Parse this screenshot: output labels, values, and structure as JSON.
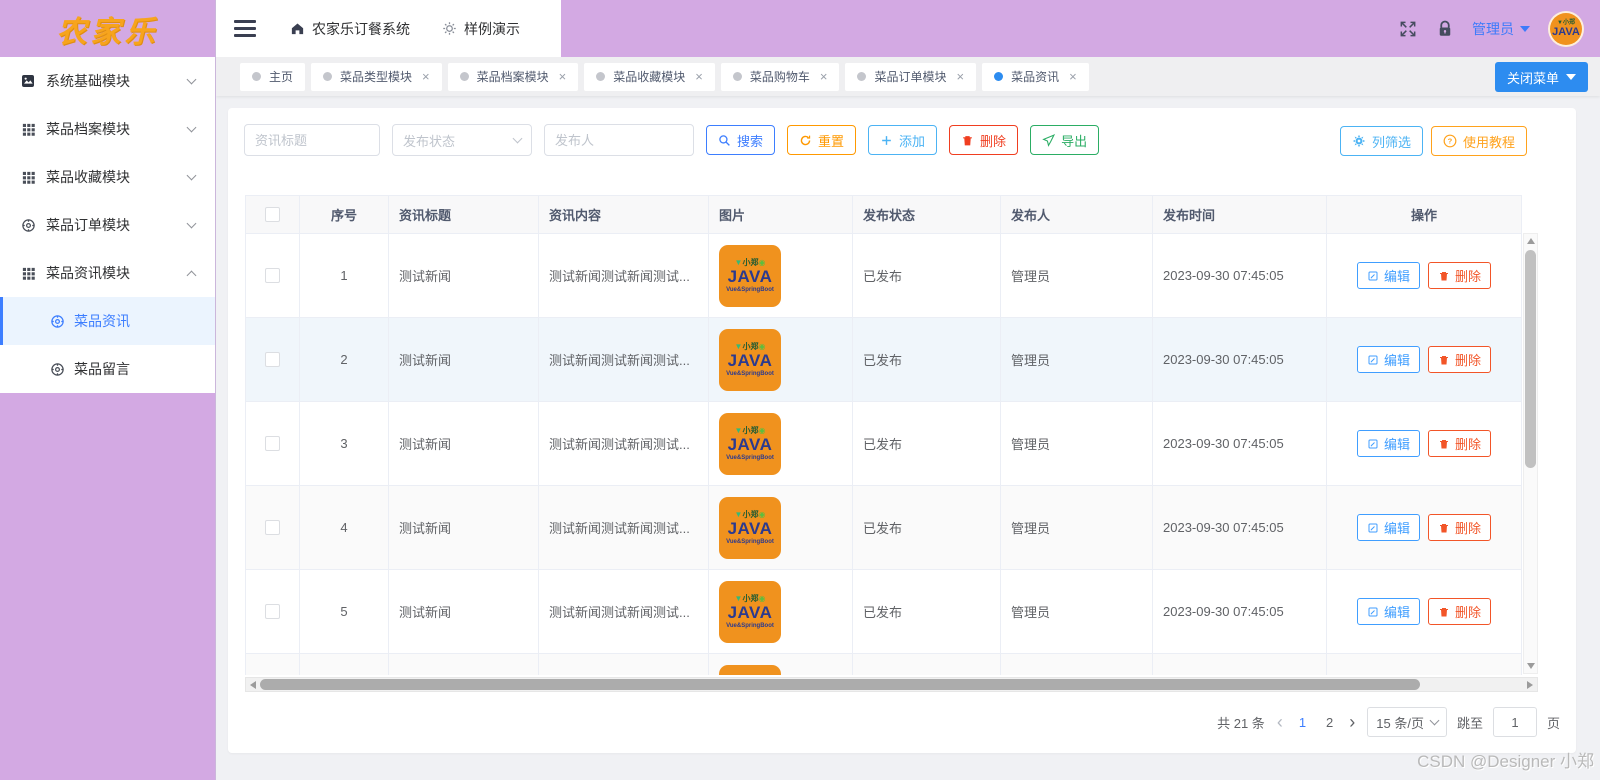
{
  "logo": "农家乐",
  "topbar": {
    "nav": [
      {
        "label": "农家乐订餐系统",
        "icon": "home-icon"
      },
      {
        "label": "样例演示",
        "icon": "bulb-icon"
      }
    ],
    "user_name": "管理员"
  },
  "tabs": {
    "items": [
      {
        "label": "主页",
        "closable": false,
        "active": false
      },
      {
        "label": "菜品类型模块",
        "closable": true,
        "active": false
      },
      {
        "label": "菜品档案模块",
        "closable": true,
        "active": false
      },
      {
        "label": "菜品收藏模块",
        "closable": true,
        "active": false
      },
      {
        "label": "菜品购物车",
        "closable": true,
        "active": false
      },
      {
        "label": "菜品订单模块",
        "closable": true,
        "active": false
      },
      {
        "label": "菜品资讯",
        "closable": true,
        "active": true
      }
    ],
    "close_menu": "关闭菜单"
  },
  "sidebar": {
    "menu": [
      {
        "label": "系统基础模块",
        "icon": "image-icon",
        "expanded": false
      },
      {
        "label": "菜品档案模块",
        "icon": "grid-icon",
        "expanded": false
      },
      {
        "label": "菜品收藏模块",
        "icon": "grid-icon",
        "expanded": false
      },
      {
        "label": "菜品订单模块",
        "icon": "compass-icon",
        "expanded": false
      },
      {
        "label": "菜品资讯模块",
        "icon": "grid-icon",
        "expanded": true
      }
    ],
    "submenu": [
      {
        "label": "菜品资讯",
        "active": true
      },
      {
        "label": "菜品留言",
        "active": false
      }
    ]
  },
  "filters": {
    "title_placeholder": "资讯标题",
    "status_placeholder": "发布状态",
    "publisher_placeholder": "发布人"
  },
  "toolbar": {
    "search": "搜索",
    "reset": "重置",
    "add": "添加",
    "delete": "删除",
    "export": "导出",
    "column_filter": "列筛选",
    "tutorial": "使用教程"
  },
  "table": {
    "headers": [
      "序号",
      "资讯标题",
      "资讯内容",
      "图片",
      "发布状态",
      "发布人",
      "发布时间",
      "操作"
    ],
    "edit_label": "编辑",
    "delete_label": "删除",
    "rows": [
      {
        "no": "1",
        "title": "测试新闻",
        "content": "测试新闻测试新闻测试...",
        "status": "已发布",
        "publisher": "管理员",
        "time": "2023-09-30 07:45:05",
        "partial": false
      },
      {
        "no": "2",
        "title": "测试新闻",
        "content": "测试新闻测试新闻测试...",
        "status": "已发布",
        "publisher": "管理员",
        "time": "2023-09-30 07:45:05",
        "partial": false
      },
      {
        "no": "3",
        "title": "测试新闻",
        "content": "测试新闻测试新闻测试...",
        "status": "已发布",
        "publisher": "管理员",
        "time": "2023-09-30 07:45:05",
        "partial": false
      },
      {
        "no": "4",
        "title": "测试新闻",
        "content": "测试新闻测试新闻测试...",
        "status": "已发布",
        "publisher": "管理员",
        "time": "2023-09-30 07:45:05",
        "partial": false
      },
      {
        "no": "5",
        "title": "测试新闻",
        "content": "测试新闻测试新闻测试...",
        "status": "已发布",
        "publisher": "管理员",
        "time": "2023-09-30 07:45:05",
        "partial": false
      },
      {
        "no": "",
        "title": "",
        "content": "",
        "status": "",
        "publisher": "",
        "time": "",
        "partial": true
      }
    ]
  },
  "badge": {
    "top": "小郑",
    "main": "JAVA",
    "sub": "Vue&SpringBoot"
  },
  "pagination": {
    "total": "共 21 条",
    "pages": [
      "1",
      "2"
    ],
    "active_page": "1",
    "page_size": "15 条/页",
    "jump_prefix": "跳至",
    "jump_value": "1",
    "jump_suffix": "页"
  },
  "watermark": "CSDN @Designer 小郑",
  "colors": {
    "purple": "#D3A9E3",
    "primary_blue": "#3D7EFF",
    "tab_blue": "#2D8CF0",
    "logo_orange": "#F7A41D",
    "badge_orange": "#F0921E"
  }
}
